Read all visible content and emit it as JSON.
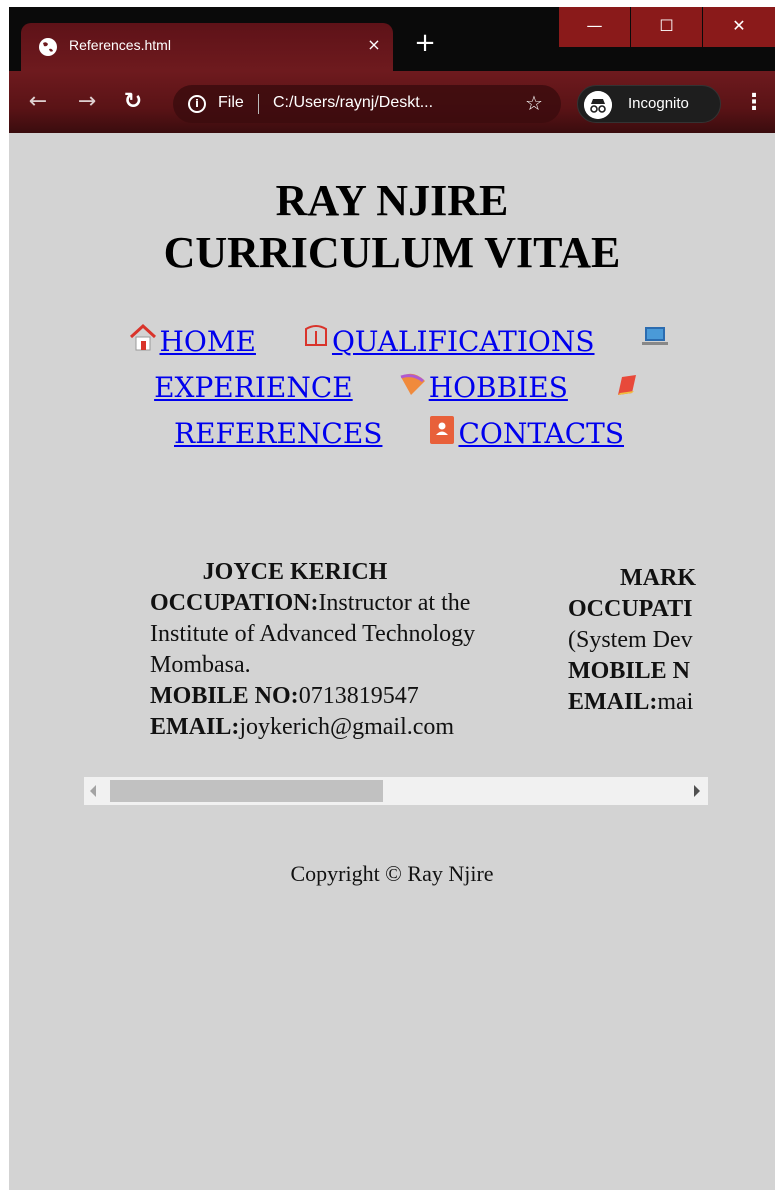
{
  "browser": {
    "tab_title": "References.html",
    "tab_close": "×",
    "new_tab": "+",
    "scheme_label": "File",
    "url": "C:/Users/raynj/Deskt...",
    "profile_label": "Incognito",
    "window_min": "—",
    "window_max": "☐",
    "window_close": "✕",
    "accent": "#7a1a1a"
  },
  "page": {
    "title_line1": "RAY NJIRE",
    "title_line2": "CURRICULUM VITAE",
    "nav": {
      "home": "HOME",
      "qualifications": "QUALIFICATIONS",
      "experience": "EXPERIENCE",
      "hobbies": "HOBBIES",
      "references": "REFERENCES",
      "contacts": "CONTACTS"
    },
    "references": [
      {
        "name": "JOYCE KERICH",
        "occupation_label": "OCCUPATION:",
        "occupation": "Instructor at the Institute of Advanced Technology Mombasa.",
        "mobile_label": "MOBILE NO:",
        "mobile": "0713819547",
        "email_label": "EMAIL:",
        "email": "joykerich@gmail.com"
      },
      {
        "name": "MARK",
        "occupation_label": "OCCUPATI",
        "occupation": "(System Dev",
        "mobile_label": "MOBILE N",
        "email_label": "EMAIL:",
        "email": "mai"
      }
    ],
    "scroll_position": 0.0,
    "footer": "Copyright © Ray Njire"
  }
}
